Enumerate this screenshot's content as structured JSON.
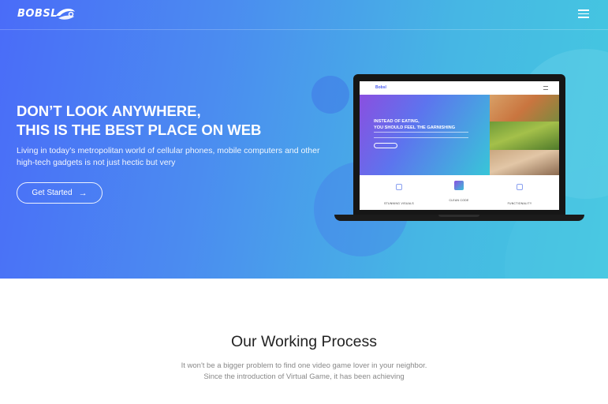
{
  "colors": {
    "hero_gradient_start": "#4a6cf8",
    "hero_gradient_end": "#44c9e0",
    "text_white": "#ffffff",
    "title_dark": "#222222",
    "desc_gray": "#888888"
  },
  "nav": {
    "logo_text": "BOBSL",
    "logo_icon": "swoosh-icon",
    "menu_icon": "hamburger-menu-icon"
  },
  "hero": {
    "headline_line1": "DON’T LOOK ANYWHERE,",
    "headline_line2": "THIS IS THE BEST PLACE ON WEB",
    "subtext": "Living in today’s metropolitan world of cellular phones, mobile computers and other high-tech gadgets is not just hectic but very",
    "cta_label": "Get Started",
    "cta_icon": "arrow-right-icon"
  },
  "laptop_screen": {
    "brand": "Bobsl",
    "title_line1": "INSTEAD OF EATING,",
    "title_line2": "YOU SHOULD FEEL THE GARNISHING",
    "features": [
      "STUNNING VISUALS",
      "CLEAN CODE",
      "FUNCTIONALITY"
    ]
  },
  "process": {
    "title": "Our Working Process",
    "desc_line1": "It won't be a bigger problem to find one video game lover in your neighbor.",
    "desc_line2": "Since the introduction of Virtual Game, it has been achieving"
  }
}
